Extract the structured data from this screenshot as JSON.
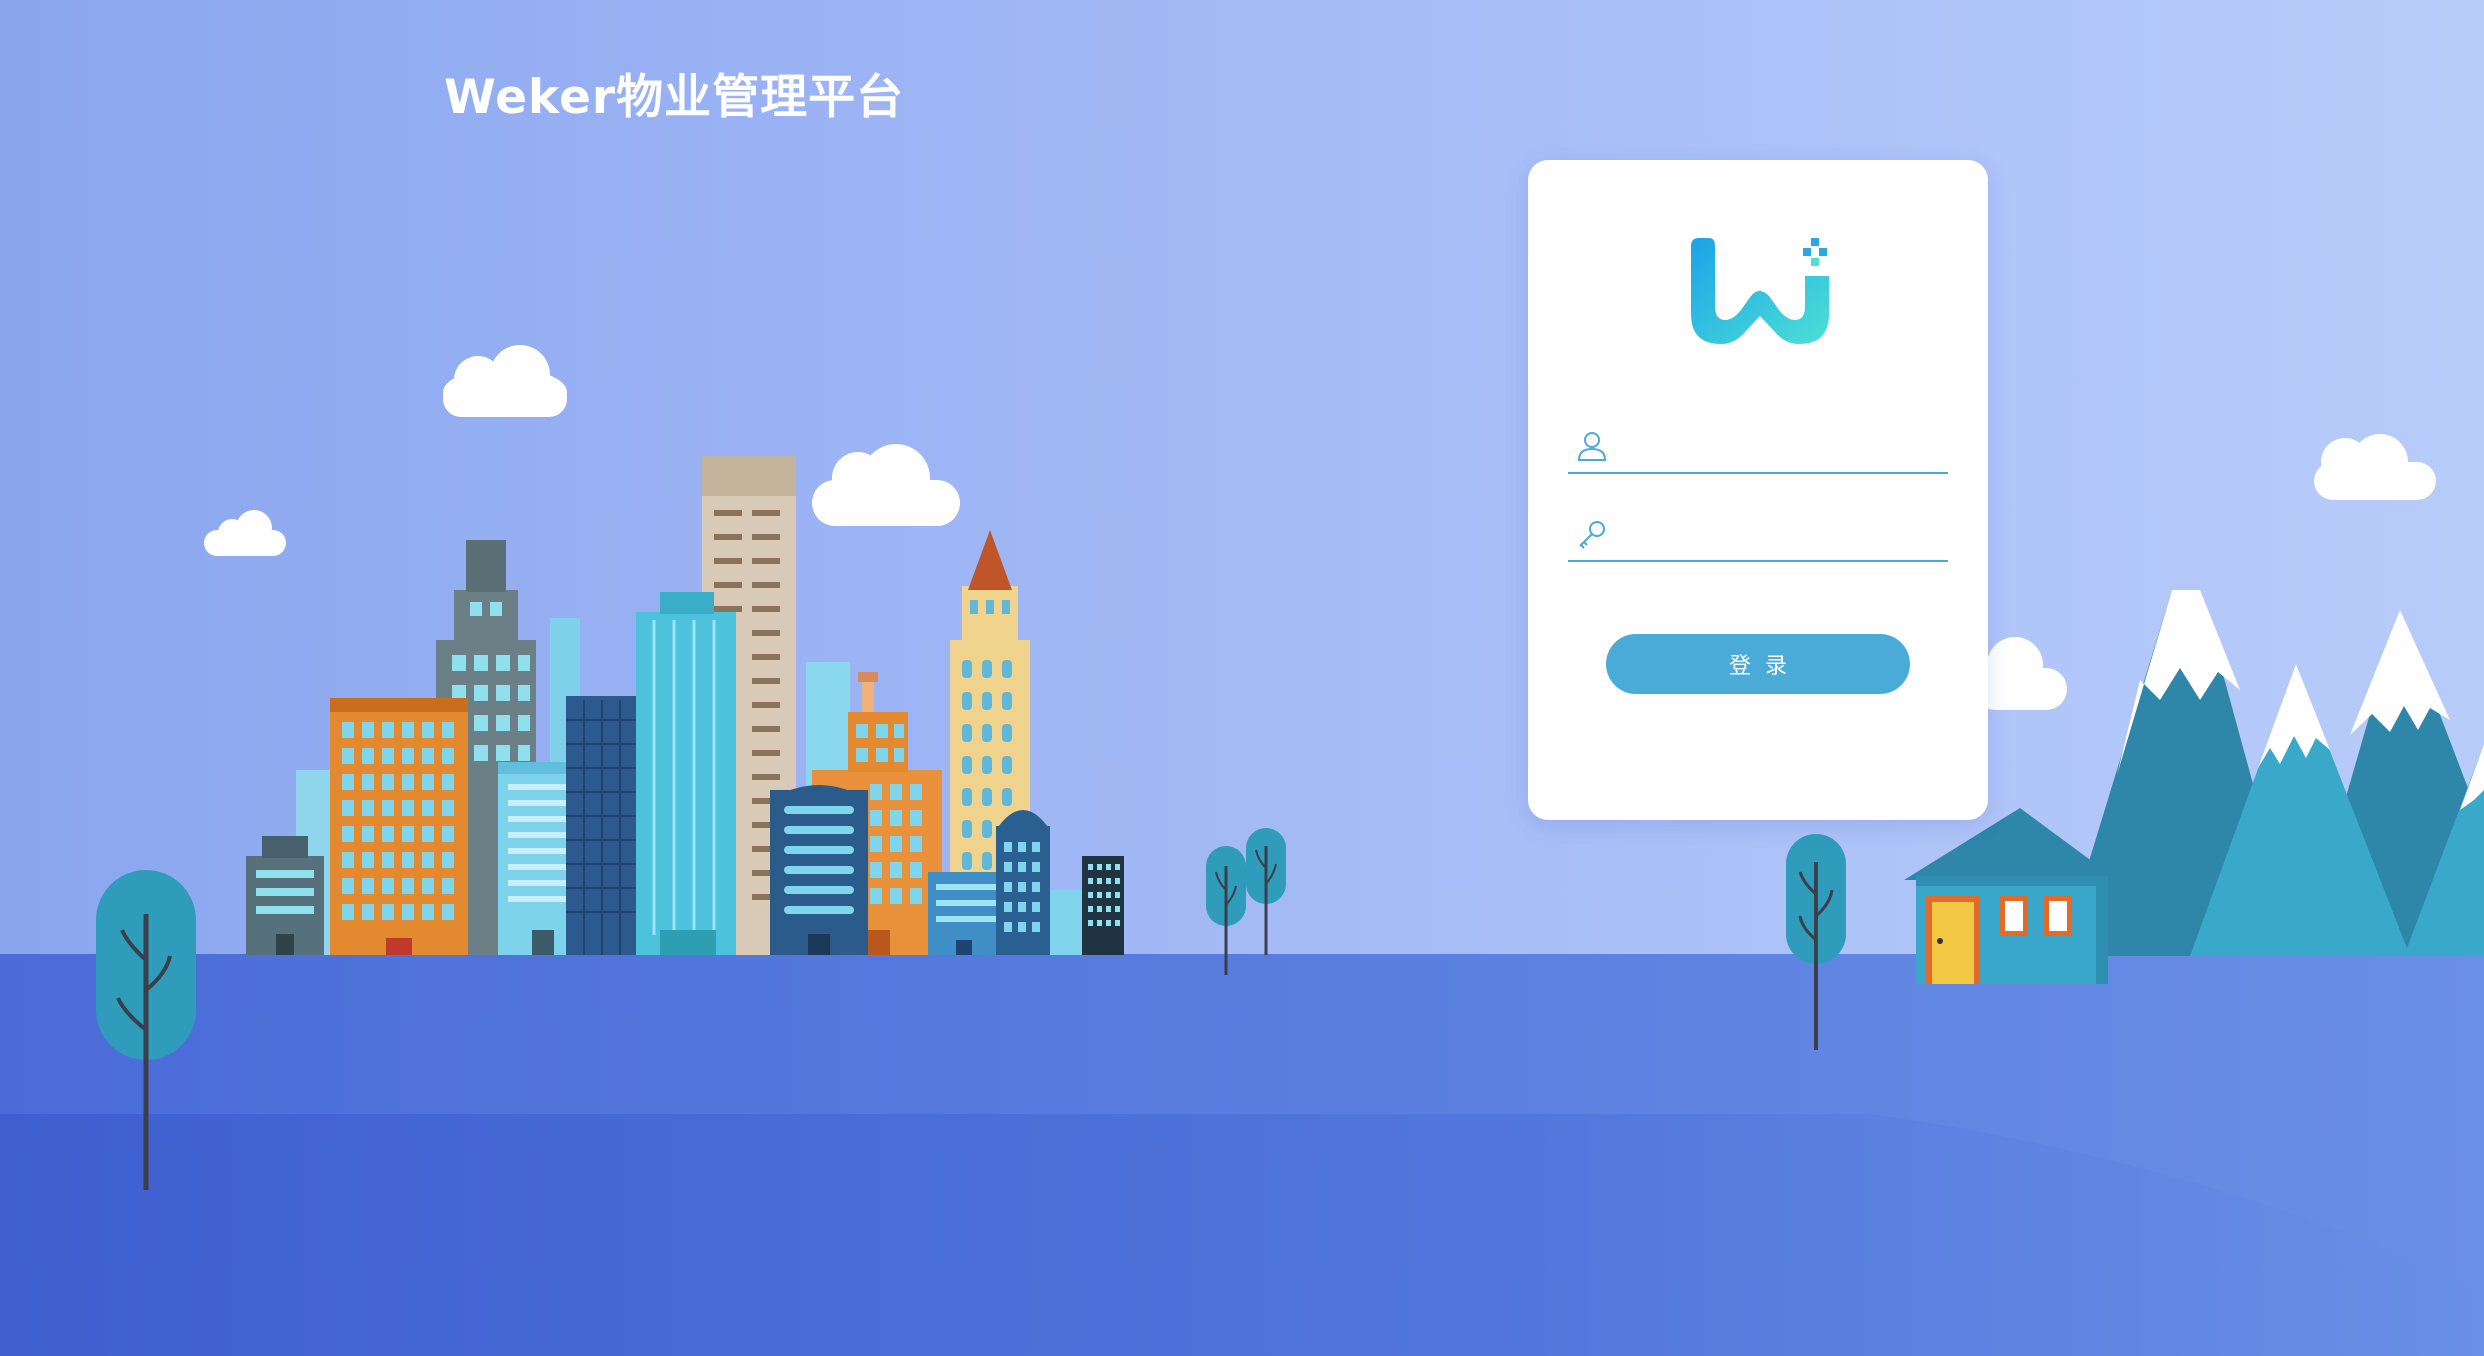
{
  "header": {
    "title": "Weker物业管理平台"
  },
  "login": {
    "logo_icon": "weker-logo-icon",
    "username": {
      "icon": "user-icon",
      "value": "",
      "placeholder": ""
    },
    "password": {
      "icon": "key-icon",
      "value": "",
      "placeholder": ""
    },
    "submit_label": "登录"
  },
  "colors": {
    "background_top": "#9fb6f5",
    "ground": "#5a7fdf",
    "ground_front": "#4a6cd6",
    "card": "#ffffff",
    "button": "#4aabd8",
    "input_underline": "#4aa9d6",
    "logo_gradient_start": "#1aa3e8",
    "logo_gradient_end": "#4de0d6"
  }
}
